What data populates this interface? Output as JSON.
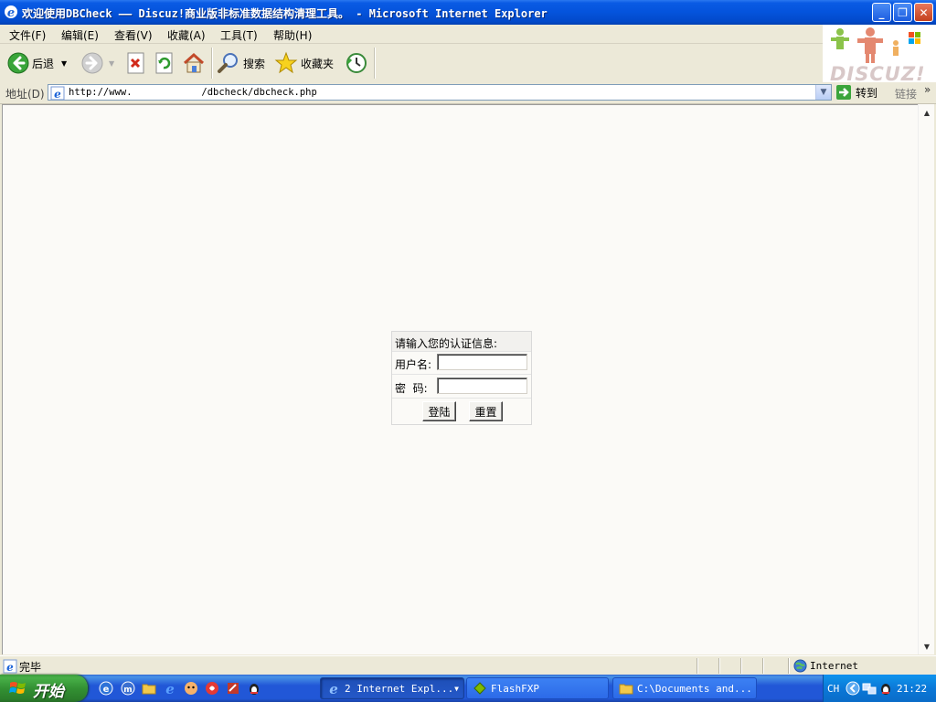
{
  "window": {
    "title": "欢迎使用DBCheck —— Discuz!商业版非标准数据结构清理工具。 - Microsoft Internet Explorer",
    "minimize_symbol": "_",
    "maximize_symbol": "❐",
    "close_symbol": "✕"
  },
  "menu": {
    "items": [
      {
        "label": "文件(F)"
      },
      {
        "label": "编辑(E)"
      },
      {
        "label": "查看(V)"
      },
      {
        "label": "收藏(A)"
      },
      {
        "label": "工具(T)"
      },
      {
        "label": "帮助(H)"
      }
    ]
  },
  "toolbar": {
    "back_label": "后退",
    "search_label": "搜索",
    "favorites_label": "收藏夹"
  },
  "address": {
    "label": "地址(D)",
    "url": "http://www.            /dbcheck/dbcheck.php",
    "go_label": "转到",
    "links_label": "链接",
    "links_chevron": "»"
  },
  "logo": {
    "text": "DISCUZ!"
  },
  "login": {
    "header": "请输入您的认证信息:",
    "username_label": "用户名:",
    "password_label": "密  码:",
    "username_value": "",
    "password_value": "",
    "login_button": "登陆",
    "reset_button": "重置"
  },
  "status": {
    "text": "完毕",
    "zone": "Internet"
  },
  "taskbar": {
    "start_label": "开始",
    "tasks": [
      {
        "label": "2 Internet Expl...",
        "active": true
      },
      {
        "label": "FlashFXP",
        "active": false
      },
      {
        "label": "C:\\Documents and...",
        "active": false
      }
    ],
    "tray_lang": "CH",
    "clock": "21:22"
  },
  "colors": {
    "titlebar": "#0453DC",
    "chrome": "#ECE9D8",
    "content_bg": "#FBFAF7",
    "taskbar": "#2157D7",
    "start_button": "#339133",
    "tray": "#0B78D8"
  },
  "icons": {
    "title_icon": "ie-icon",
    "back": "back-arrow-icon",
    "forward": "forward-arrow-icon",
    "stop": "stop-icon",
    "refresh": "refresh-icon",
    "home": "home-icon",
    "search": "search-magnifier-icon",
    "favorites": "star-icon",
    "history": "history-icon",
    "go": "go-arrow-icon",
    "zone": "globe-icon"
  }
}
